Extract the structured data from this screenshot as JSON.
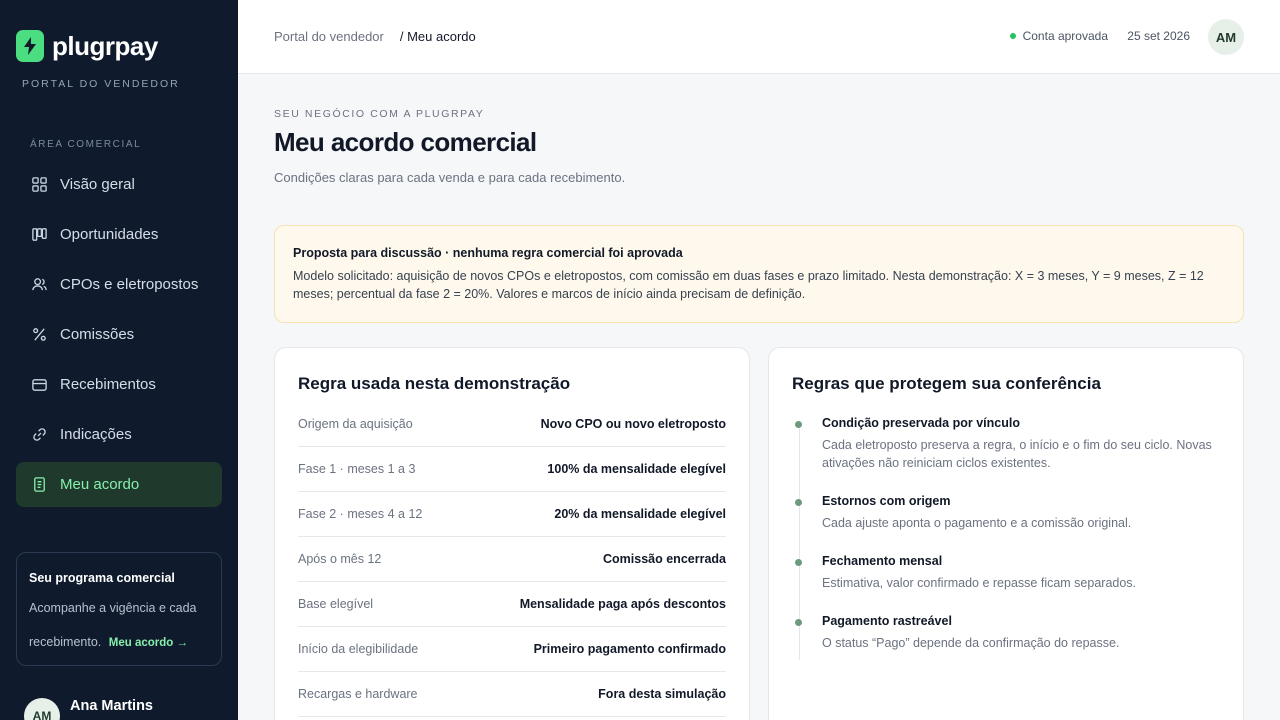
{
  "brand": {
    "name": "plugrpay",
    "subtitle": "PORTAL DO VENDEDOR"
  },
  "sidebar": {
    "section_label": "ÁREA COMERCIAL",
    "items": [
      {
        "label": "Visão geral",
        "icon": "grid-icon"
      },
      {
        "label": "Oportunidades",
        "icon": "kanban-icon"
      },
      {
        "label": "CPOs e eletropostos",
        "icon": "users-icon"
      },
      {
        "label": "Comissões",
        "icon": "percent-icon"
      },
      {
        "label": "Recebimentos",
        "icon": "wallet-icon"
      },
      {
        "label": "Indicações",
        "icon": "link-icon"
      },
      {
        "label": "Meu acordo",
        "icon": "document-icon",
        "active": true
      }
    ],
    "promo": {
      "title": "Seu programa comercial",
      "text": "Acompanhe a vigência e cada recebimento.",
      "link": "Meu acordo →"
    },
    "user": {
      "initials": "AM",
      "name": "Ana Martins"
    }
  },
  "topbar": {
    "breadcrumb": {
      "root": "Portal do vendedor",
      "current": "/ Meu acordo"
    },
    "status": "Conta aprovada",
    "date": "25 set 2026",
    "avatar": "AM"
  },
  "header": {
    "eyebrow": "SEU NEGÓCIO COM A PLUGRPAY",
    "title": "Meu acordo comercial",
    "subtitle": "Condições claras para cada venda e para cada recebimento."
  },
  "notice": {
    "title": "Proposta para discussão · nenhuma regra comercial foi aprovada",
    "text": "Modelo solicitado: aquisição de novos CPOs e eletropostos, com comissão em duas fases e prazo limitado. Nesta demonstração: X = 3 meses, Y = 9 meses, Z = 12 meses; percentual da fase 2 = 20%. Valores e marcos de início ainda precisam de definição."
  },
  "rules": {
    "title": "Regra usada nesta demonstração",
    "rows": [
      {
        "label": "Origem da aquisição",
        "value": "Novo CPO ou novo eletroposto"
      },
      {
        "label": "Fase 1 · meses 1 a 3",
        "value": "100% da mensalidade elegível"
      },
      {
        "label": "Fase 2 · meses 4 a 12",
        "value": "20% da mensalidade elegível"
      },
      {
        "label": "Após o mês 12",
        "value": "Comissão encerrada"
      },
      {
        "label": "Base elegível",
        "value": "Mensalidade paga após descontos"
      },
      {
        "label": "Início da elegibilidade",
        "value": "Primeiro pagamento confirmado"
      },
      {
        "label": "Recargas e hardware",
        "value": "Fora desta simulação"
      }
    ]
  },
  "protections": {
    "title": "Regras que protegem sua conferência",
    "items": [
      {
        "title": "Condição preservada por vínculo",
        "text": "Cada eletroposto preserva a regra, o início e o fim do seu ciclo. Novas ativações não reiniciam ciclos existentes."
      },
      {
        "title": "Estornos com origem",
        "text": "Cada ajuste aponta o pagamento e a comissão original."
      },
      {
        "title": "Fechamento mensal",
        "text": "Estimativa, valor confirmado e repasse ficam separados."
      },
      {
        "title": "Pagamento rastreável",
        "text": "O status “Pago” depende da confirmação do repasse."
      }
    ]
  }
}
